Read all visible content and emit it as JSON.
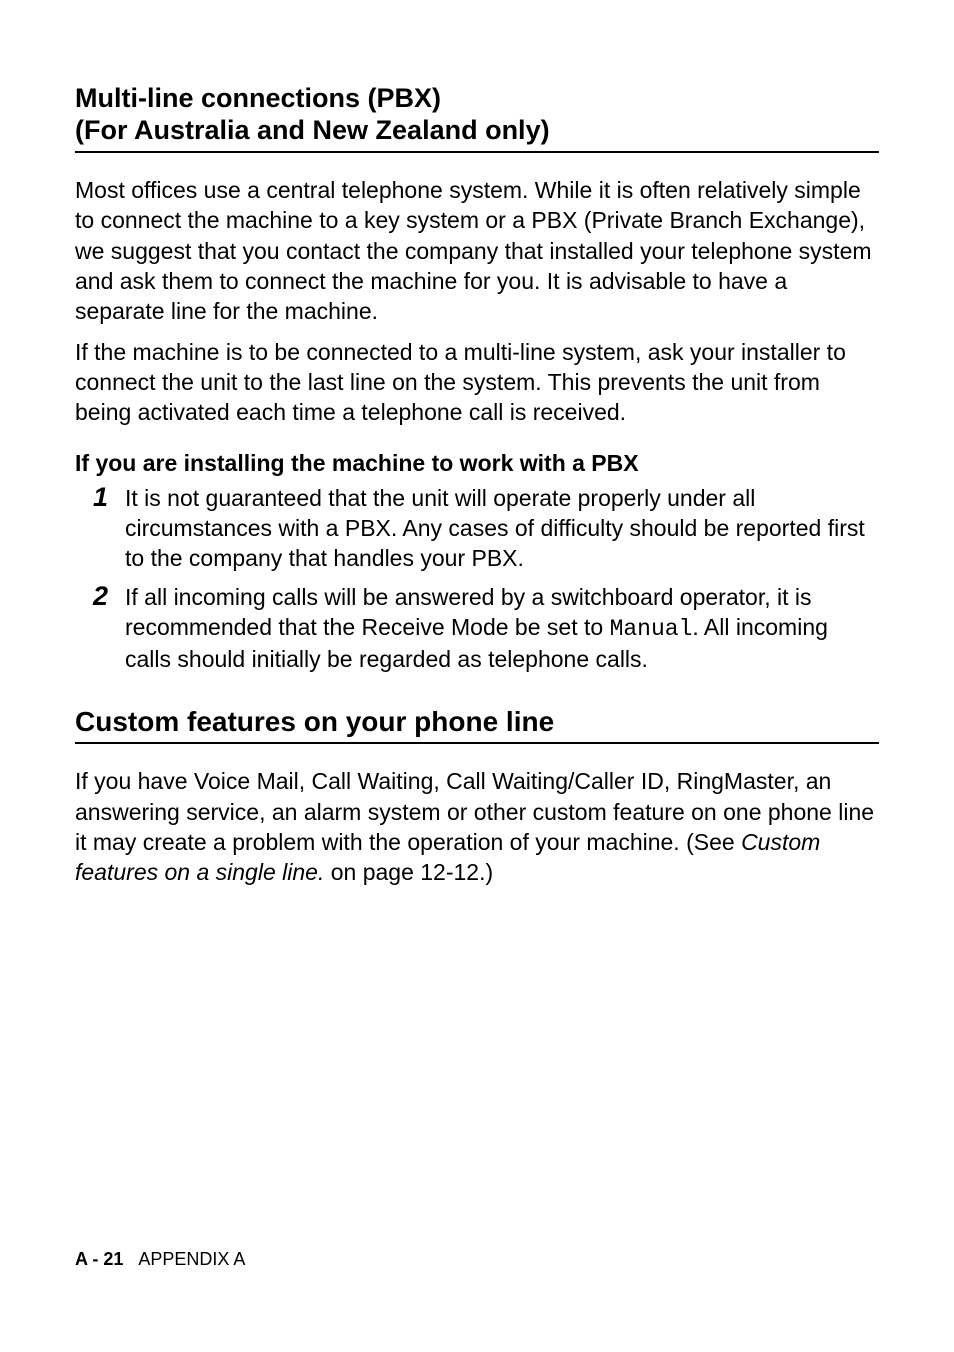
{
  "heading1_line1": "Multi-line connections (PBX)",
  "heading1_line2": "(For Australia and New Zealand only)",
  "para1": "Most offices use a central telephone system. While it is often relatively simple to connect the machine to a key system or a PBX (Private Branch Exchange), we suggest that you contact the company that installed your telephone system and ask them to connect the machine for you. It is advisable to have a separate line for the machine.",
  "para2": "If the machine is to be connected to a multi-line system, ask your installer to connect the unit to the last line on the system. This prevents the unit from being activated each time a telephone call is received.",
  "sub_heading": "If you are installing the machine to work with a PBX",
  "list": {
    "num1": "1",
    "text1": "It is not guaranteed that the unit will operate properly under all circumstances with a PBX. Any cases of difficulty should be reported first to the company that handles your PBX.",
    "num2": "2",
    "text2a": "If all incoming calls will be answered by a switchboard operator, it is recommended that the Receive Mode be set to ",
    "text2_mono": "Manual",
    "text2b": ". All incoming calls should initially be regarded as telephone calls."
  },
  "heading2": "Custom features on your phone line",
  "para3a": "If you have Voice Mail, Call Waiting, Call Waiting/Caller ID, RingMaster, an answering service, an alarm system or other custom feature on one phone line it may create a problem with the operation of your machine. (See ",
  "para3_italic": "Custom features on a single line.",
  "para3b": " on page 12-12.)",
  "footer_page": "A - 21",
  "footer_label": "APPENDIX A"
}
